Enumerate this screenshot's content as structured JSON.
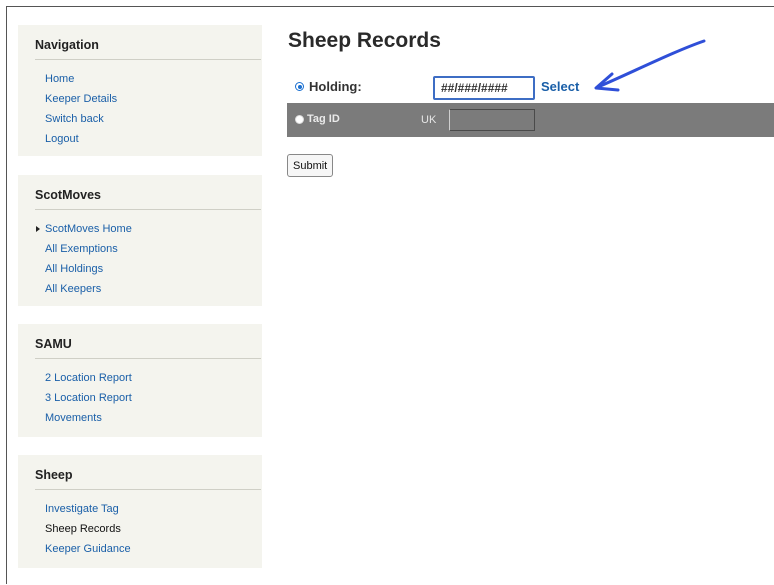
{
  "sidebar": [
    {
      "title": "Navigation",
      "items": [
        {
          "label": "Home"
        },
        {
          "label": "Keeper Details"
        },
        {
          "label": "Switch back"
        },
        {
          "label": "Logout"
        }
      ]
    },
    {
      "title": "ScotMoves",
      "items": [
        {
          "label": "ScotMoves Home",
          "marker": true
        },
        {
          "label": "All Exemptions"
        },
        {
          "label": "All Holdings"
        },
        {
          "label": "All Keepers"
        }
      ]
    },
    {
      "title": "SAMU",
      "items": [
        {
          "label": "2 Location Report"
        },
        {
          "label": "3 Location Report"
        },
        {
          "label": "Movements"
        }
      ]
    },
    {
      "title": "Sheep",
      "items": [
        {
          "label": "Investigate Tag"
        },
        {
          "label": "Sheep Records",
          "current": true
        },
        {
          "label": "Keeper Guidance"
        }
      ]
    }
  ],
  "main": {
    "title": "Sheep Records",
    "holding": {
      "label": "Holding:",
      "value": "##/###/####",
      "select_label": "Select",
      "selected": true
    },
    "tag": {
      "label": "Tag ID",
      "prefix": "UK",
      "value": "",
      "selected": false
    },
    "submit_label": "Submit"
  },
  "annotation": {
    "color": "#2f4fd8",
    "icon": "arrow-icon"
  }
}
